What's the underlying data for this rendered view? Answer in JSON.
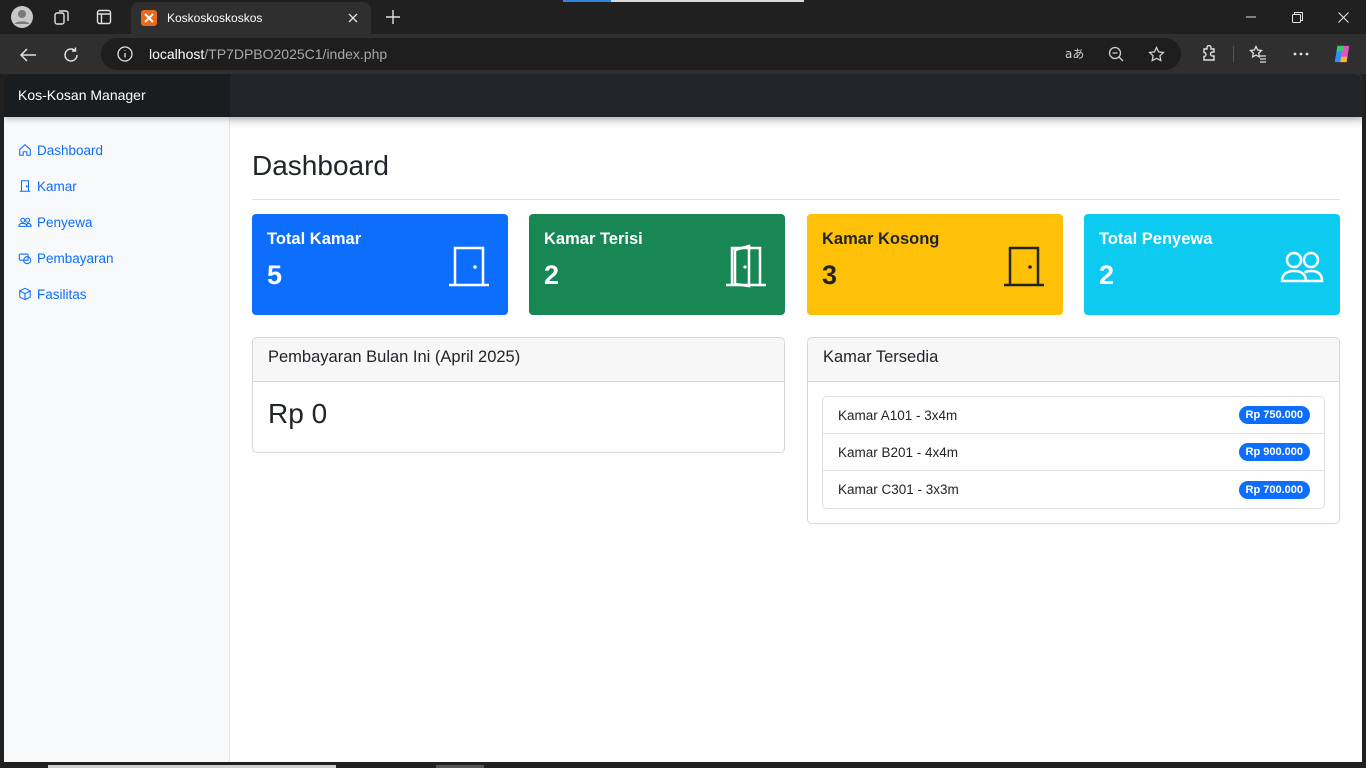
{
  "browser": {
    "tab_title": "Koskoskoskoskos",
    "url_host": "localhost",
    "url_path": "/TP7DPBO2025C1/index.php"
  },
  "navbar": {
    "brand": "Kos-Kosan Manager"
  },
  "sidebar": {
    "items": [
      {
        "label": "Dashboard",
        "icon": "house-icon"
      },
      {
        "label": "Kamar",
        "icon": "door-icon"
      },
      {
        "label": "Penyewa",
        "icon": "people-icon"
      },
      {
        "label": "Pembayaran",
        "icon": "cash-icon"
      },
      {
        "label": "Fasilitas",
        "icon": "box-icon"
      }
    ]
  },
  "main": {
    "title": "Dashboard",
    "stats": [
      {
        "label": "Total Kamar",
        "value": "5",
        "color": "#0d6efd",
        "icon": "door-closed-icon"
      },
      {
        "label": "Kamar Terisi",
        "value": "2",
        "color": "#198754",
        "icon": "door-open-icon"
      },
      {
        "label": "Kamar Kosong",
        "value": "3",
        "color": "#ffc107",
        "icon": "door-closed-icon"
      },
      {
        "label": "Total Penyewa",
        "value": "2",
        "color": "#0dcaf0",
        "icon": "people-icon"
      }
    ],
    "payment": {
      "title": "Pembayaran Bulan Ini (April 2025)",
      "amount": "Rp 0"
    },
    "available": {
      "title": "Kamar Tersedia",
      "rooms": [
        {
          "name": "Kamar A101 - 3x4m",
          "price": "Rp 750.000"
        },
        {
          "name": "Kamar B201 - 4x4m",
          "price": "Rp 900.000"
        },
        {
          "name": "Kamar C301 - 3x3m",
          "price": "Rp 700.000"
        }
      ]
    }
  }
}
